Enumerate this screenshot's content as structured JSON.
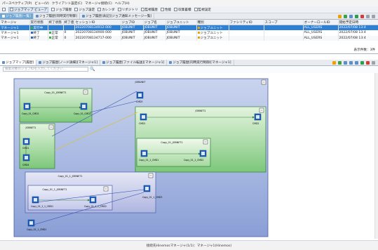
{
  "menu": [
    "パースペクティブ(P)",
    "ビュー(V)",
    "クライアント設定(C)",
    "マネージャ接続(C)",
    "ヘルプ(H)"
  ],
  "toolbar": [
    "ジョブマップ ビューア",
    "ジョブ履歴",
    "ジョブ設定",
    "カレンダ",
    "リポジトリ",
    "監視履歴",
    "性能",
    "収集蓄積",
    "監視設定"
  ],
  "tabs1": [
    {
      "label": "ジョブ履歴[一覧]",
      "active": true
    },
    {
      "label": "ジョブ履歴[同時実行制御]",
      "active": false
    },
    {
      "label": "ジョブ履歴[表記][ジョブ通知メッセージ一覧]",
      "active": false
    }
  ],
  "grid": {
    "headers": [
      "マネージャ",
      "実行状態",
      "終了状態",
      "終了値",
      "セッションID",
      "ジョブID",
      "ジョブ名",
      "ジョブユニット",
      "種別",
      "ファシリティID",
      "スコープ",
      "オーナーロールID",
      "開始予定日時"
    ],
    "rows": [
      {
        "cells": [
          "マネージャ1",
          "実行中",
          "",
          "",
          "20220708134912-000",
          "JOBUNIT",
          "JOBUNIT",
          "JOBUNIT",
          "ジョブユニット",
          "",
          "",
          "ALL_USERS",
          "2022/07/08 13:4"
        ],
        "status_color": "#3cb043",
        "end_color": "",
        "selected": true
      },
      {
        "cells": [
          "マネージャ1",
          "終了",
          "正常",
          "0",
          "20220708134900-000",
          "JOBUNIT",
          "JOBUNIT",
          "JOBUNIT",
          "ジョブユニット",
          "",
          "",
          "ALL_USERS",
          "2022/07/08 13:4"
        ],
        "status_color": "#2a64c5",
        "end_color": "#3cb043",
        "selected": false
      },
      {
        "cells": [
          "マネージャ1",
          "終了",
          "正常",
          "0",
          "20220708134717-000",
          "JOBUNIT",
          "JOBUNIT",
          "JOBUNIT",
          "ジョブユニット",
          "",
          "",
          "ALL_USERS",
          "2022/07/08 13:4"
        ],
        "status_color": "#2a64c5",
        "end_color": "#3cb043",
        "selected": false
      }
    ],
    "footer": "表示件数：3件"
  },
  "tabs2": [
    {
      "label": "ジョブマップ[履歴]",
      "active": true
    },
    {
      "label": "ジョブ履歴[ノード詳細][マネージャ1]",
      "active": false
    },
    {
      "label": "ジョブ履歴[ファイル転送][マネージャ1]",
      "active": false
    },
    {
      "label": "ジョブ履歴[同時実行制御][マネージャ1]",
      "active": false
    }
  ],
  "search": {
    "placeholder": "検索対象のジョブIDを入力してください..."
  },
  "map": {
    "root": "JOBUNIT",
    "groups": {
      "g1": "Copy_01_JOBNET1",
      "g2": "JOBNET1",
      "g3": "JOBNET1",
      "g4": "Copy_01_JOBNET1",
      "g5": "Copy_01_1_JOBNET1",
      "g6": "Copy_01_1_JOBNET1"
    },
    "jobs": {
      "j1": "Copy_01_CMD1",
      "j2": "Copy_01_CMD2",
      "j3": "CMD1",
      "j4": "CMD4",
      "j5": "CMD3",
      "j6": "CMD1",
      "j7": "CMD2",
      "j8": "Copy_01_1_CMD1",
      "j9": "Copy_01_1_CMD2",
      "j10": "Copy_01_1_CMD3",
      "j11": "Copy_01_1_1_CMD1",
      "j12": "Copy_01_1_1_CMD2",
      "j13": "Copy_01_1_CMD1"
    }
  },
  "status": "接続先Hinemosマネージャ(1/1)：マネージャ1(Hinemos)"
}
